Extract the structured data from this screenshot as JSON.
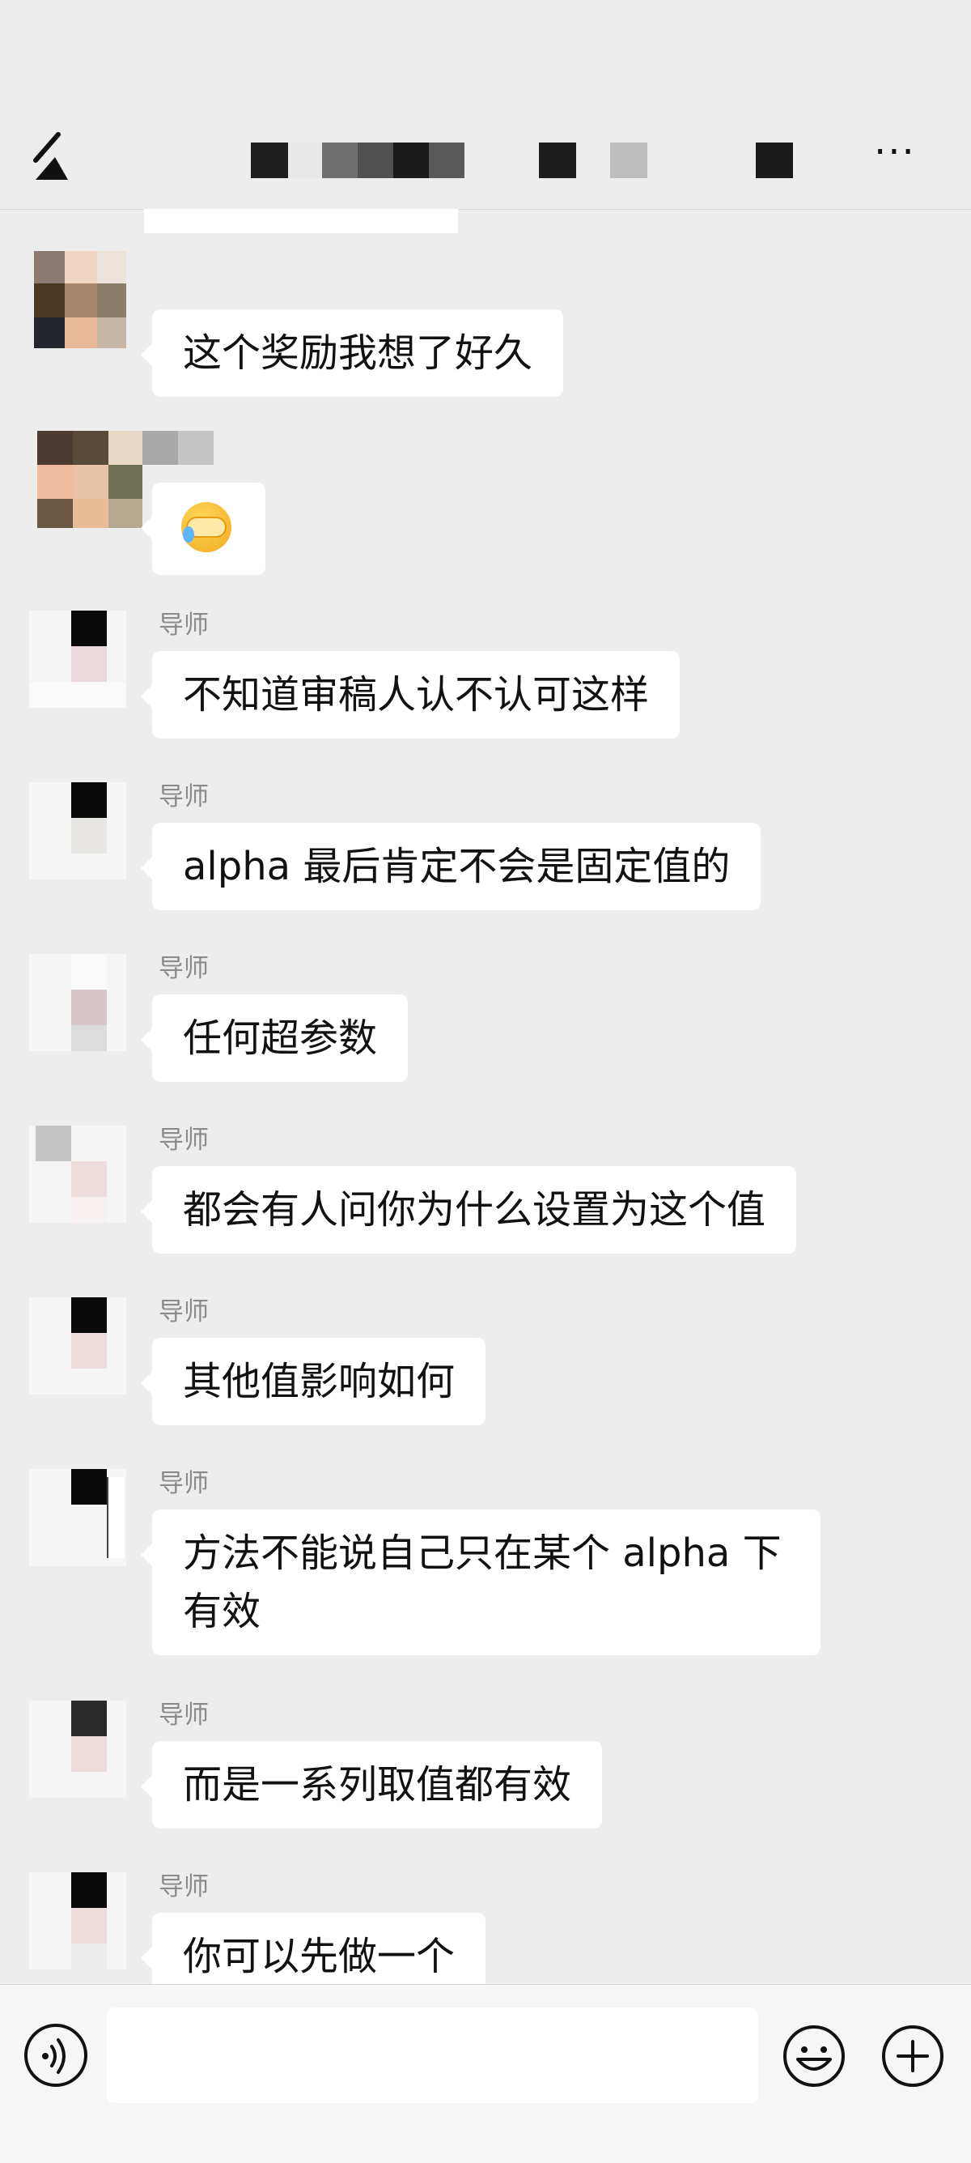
{
  "header": {
    "more_label": "···"
  },
  "messages": [
    {
      "sender": "",
      "text": "这个奖励我想了好久"
    },
    {
      "sender": "",
      "text": ""
    },
    {
      "sender": "导师",
      "text": "不知道审稿人认不认可这样"
    },
    {
      "sender": "导师",
      "text": "alpha 最后肯定不会是固定值的"
    },
    {
      "sender": "导师",
      "text": "任何超参数"
    },
    {
      "sender": "导师",
      "text": "都会有人问你为什么设置为这个值"
    },
    {
      "sender": "导师",
      "text": "其他值影响如何"
    },
    {
      "sender": "导师",
      "text": "方法不能说自己只在某个 alpha 下有效"
    },
    {
      "sender": "导师",
      "text": "而是一系列取值都有效"
    },
    {
      "sender": "导师",
      "text": "你可以先做一个"
    }
  ],
  "icons": {
    "back": "back-arrow-icon",
    "more": "more-icon",
    "voice": "voice-icon",
    "emoji": "emoji-icon",
    "plus": "plus-icon",
    "reaction": "crying-laughing-emoji"
  }
}
